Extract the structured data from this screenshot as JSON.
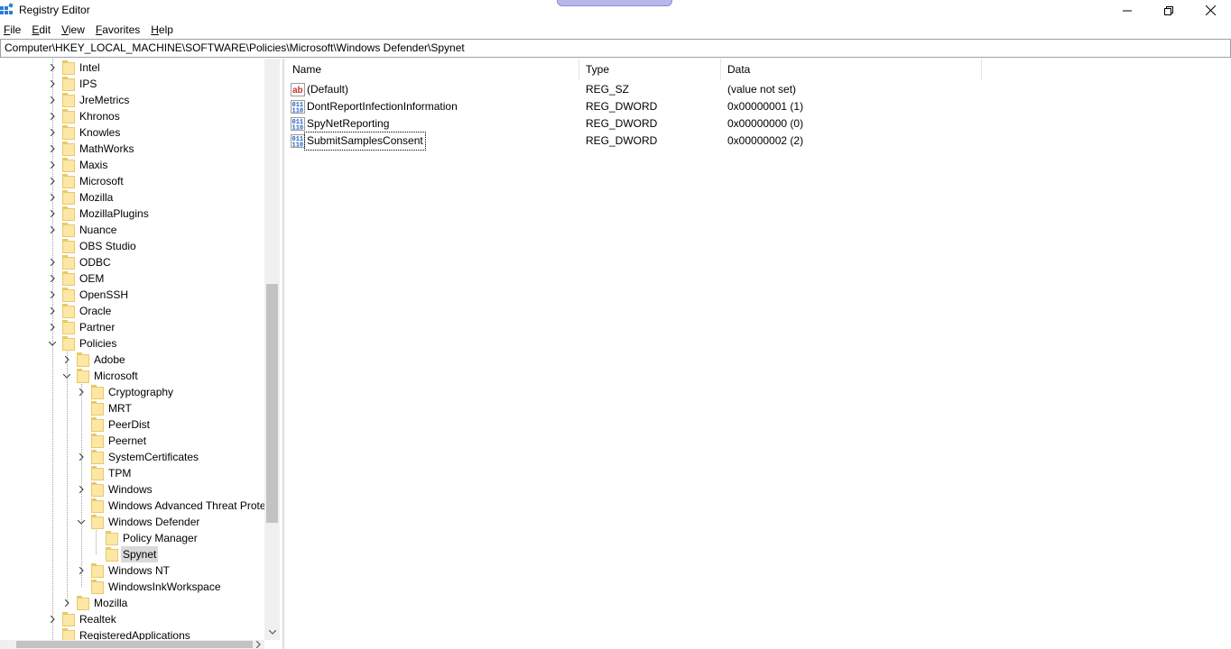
{
  "window": {
    "title": "Registry Editor"
  },
  "menu": {
    "items": [
      {
        "label_u": "F",
        "label_rest": "ile"
      },
      {
        "label_u": "E",
        "label_rest": "dit"
      },
      {
        "label_u": "V",
        "label_rest": "iew"
      },
      {
        "label_u": "F",
        "label_rest": "avorites"
      },
      {
        "label_u": "H",
        "label_rest": "elp"
      }
    ]
  },
  "address": {
    "path": "Computer\\HKEY_LOCAL_MACHINE\\SOFTWARE\\Policies\\Microsoft\\Windows Defender\\Spynet"
  },
  "tree": {
    "items": [
      {
        "label": "Intel",
        "expander": "collapsed",
        "level": 0
      },
      {
        "label": "IPS",
        "expander": "collapsed",
        "level": 0
      },
      {
        "label": "JreMetrics",
        "expander": "collapsed",
        "level": 0
      },
      {
        "label": "Khronos",
        "expander": "collapsed",
        "level": 0
      },
      {
        "label": "Knowles",
        "expander": "collapsed",
        "level": 0
      },
      {
        "label": "MathWorks",
        "expander": "collapsed",
        "level": 0
      },
      {
        "label": "Maxis",
        "expander": "collapsed",
        "level": 0
      },
      {
        "label": "Microsoft",
        "expander": "collapsed",
        "level": 0
      },
      {
        "label": "Mozilla",
        "expander": "collapsed",
        "level": 0
      },
      {
        "label": "MozillaPlugins",
        "expander": "collapsed",
        "level": 0
      },
      {
        "label": "Nuance",
        "expander": "collapsed",
        "level": 0
      },
      {
        "label": "OBS Studio",
        "expander": "none",
        "level": 0
      },
      {
        "label": "ODBC",
        "expander": "collapsed",
        "level": 0
      },
      {
        "label": "OEM",
        "expander": "collapsed",
        "level": 0
      },
      {
        "label": "OpenSSH",
        "expander": "collapsed",
        "level": 0
      },
      {
        "label": "Oracle",
        "expander": "collapsed",
        "level": 0
      },
      {
        "label": "Partner",
        "expander": "collapsed",
        "level": 0
      },
      {
        "label": "Policies",
        "expander": "expanded",
        "level": 0
      },
      {
        "label": "Adobe",
        "expander": "collapsed",
        "level": 1
      },
      {
        "label": "Microsoft",
        "expander": "expanded",
        "level": 1
      },
      {
        "label": "Cryptography",
        "expander": "collapsed",
        "level": 2
      },
      {
        "label": "MRT",
        "expander": "none",
        "level": 2
      },
      {
        "label": "PeerDist",
        "expander": "none",
        "level": 2
      },
      {
        "label": "Peernet",
        "expander": "none",
        "level": 2
      },
      {
        "label": "SystemCertificates",
        "expander": "collapsed",
        "level": 2
      },
      {
        "label": "TPM",
        "expander": "none",
        "level": 2
      },
      {
        "label": "Windows",
        "expander": "collapsed",
        "level": 2
      },
      {
        "label": "Windows Advanced Threat Prote",
        "expander": "none",
        "level": 2
      },
      {
        "label": "Windows Defender",
        "expander": "expanded",
        "level": 2
      },
      {
        "label": "Policy Manager",
        "expander": "none",
        "level": 3
      },
      {
        "label": "Spynet",
        "expander": "none",
        "level": 3,
        "selected": true
      },
      {
        "label": "Windows NT",
        "expander": "collapsed",
        "level": 2
      },
      {
        "label": "WindowsInkWorkspace",
        "expander": "none",
        "level": 2
      },
      {
        "label": "Mozilla",
        "expander": "collapsed",
        "level": 1
      },
      {
        "label": "Realtek",
        "expander": "collapsed",
        "level": 0
      },
      {
        "label": "RegisteredApplications",
        "expander": "none",
        "level": 0
      }
    ]
  },
  "list": {
    "columns": {
      "name": "Name",
      "type": "Type",
      "data": "Data"
    },
    "rows": [
      {
        "name": "(Default)",
        "type": "REG_SZ",
        "data": "(value not set)",
        "icon": "string-value-icon"
      },
      {
        "name": "DontReportInfectionInformation",
        "type": "REG_DWORD",
        "data": "0x00000001 (1)",
        "icon": "binary-value-icon"
      },
      {
        "name": "SpyNetReporting",
        "type": "REG_DWORD",
        "data": "0x00000000 (0)",
        "icon": "binary-value-icon"
      },
      {
        "name": "SubmitSamplesConsent",
        "type": "REG_DWORD",
        "data": "0x00000002 (2)",
        "icon": "binary-value-icon",
        "focused": true
      }
    ]
  },
  "colors": {
    "selection": "#d9d9d9",
    "folder": "#fce7a4",
    "pill": "#b9b6ec"
  }
}
